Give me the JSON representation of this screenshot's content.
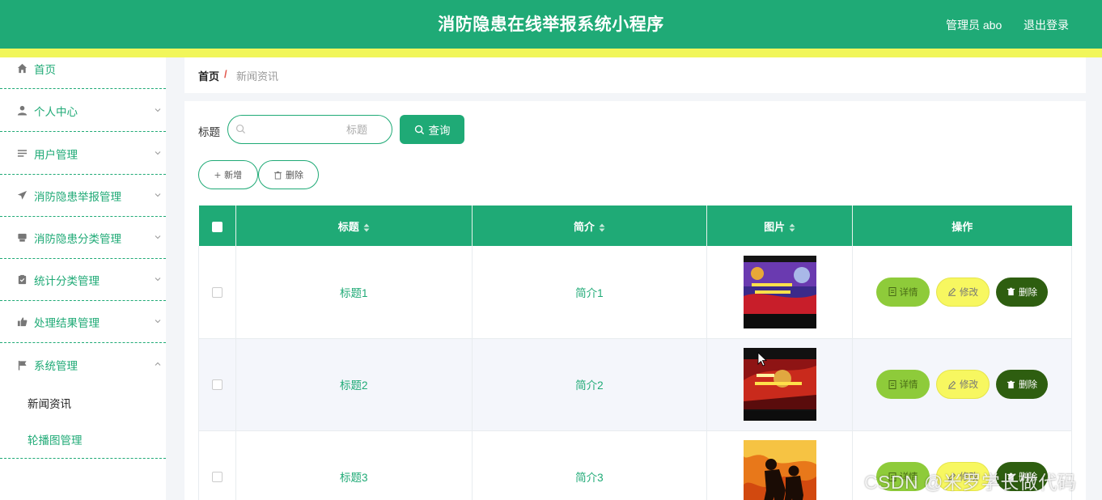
{
  "app": {
    "title": "消防隐患在线举报系统小程序",
    "user": "管理员 abo",
    "logout": "退出登录"
  },
  "colors": {
    "primary": "#1faa76",
    "accent_bar": "#f1f65a",
    "detail_btn": "#8ecb3a",
    "edit_btn": "#f7f760",
    "delete_btn": "#2e5e10"
  },
  "sidebar": {
    "items": [
      {
        "label": "首页",
        "icon": "home-icon",
        "chevron": "none"
      },
      {
        "label": "个人中心",
        "icon": "user-icon",
        "chevron": "down"
      },
      {
        "label": "用户管理",
        "icon": "list-icon",
        "chevron": "down"
      },
      {
        "label": "消防隐患举报管理",
        "icon": "send-icon",
        "chevron": "down"
      },
      {
        "label": "消防隐患分类管理",
        "icon": "printer-icon",
        "chevron": "down"
      },
      {
        "label": "统计分类管理",
        "icon": "clipboard-check-icon",
        "chevron": "down"
      },
      {
        "label": "处理结果管理",
        "icon": "thumb-up-icon",
        "chevron": "down"
      },
      {
        "label": "系统管理",
        "icon": "flag-icon",
        "chevron": "up"
      }
    ],
    "sub_items": [
      {
        "label": "新闻资讯",
        "active": true
      },
      {
        "label": "轮播图管理",
        "active": false
      }
    ]
  },
  "breadcrumb": {
    "home": "首页",
    "separator": "/",
    "current": "新闻资讯"
  },
  "search": {
    "label": "标题",
    "placeholder": "标题",
    "value": "",
    "button": "查询"
  },
  "actions": {
    "add": "新增",
    "delete": "删除"
  },
  "table": {
    "columns": [
      "标题",
      "简介",
      "图片",
      "操作"
    ],
    "rows": [
      {
        "title": "标题1",
        "intro": "简介1",
        "image": "fire-safety-banner-1"
      },
      {
        "title": "标题2",
        "intro": "简介2",
        "image": "fire-safety-banner-2"
      },
      {
        "title": "标题3",
        "intro": "简介3",
        "image": "firefighters-flames"
      }
    ],
    "ops": {
      "detail": "详情",
      "edit": "修改",
      "delete": "删除"
    }
  },
  "watermark": "CSDN @米罗学长做代码"
}
